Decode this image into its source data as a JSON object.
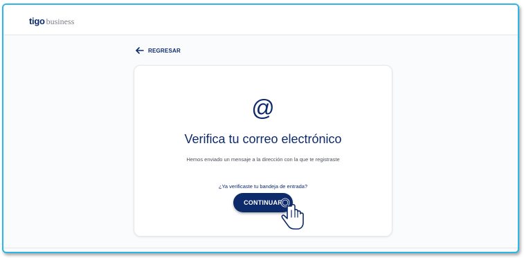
{
  "header": {
    "brand_name": "tigo",
    "brand_suffix": "business"
  },
  "back_link": {
    "label": "REGRESAR"
  },
  "card": {
    "icon": "at-icon",
    "icon_glyph": "@",
    "title": "Verifica tu correo electrónico",
    "message": "Hemos enviado un mensaje a la dirección con la que te registraste",
    "question": "¿Ya verificaste tu bandeja de entrada?",
    "button_label": "CONTINUAR"
  },
  "colors": {
    "brand_navy": "#0d2a6b",
    "frame_border": "#2bb5e8"
  }
}
